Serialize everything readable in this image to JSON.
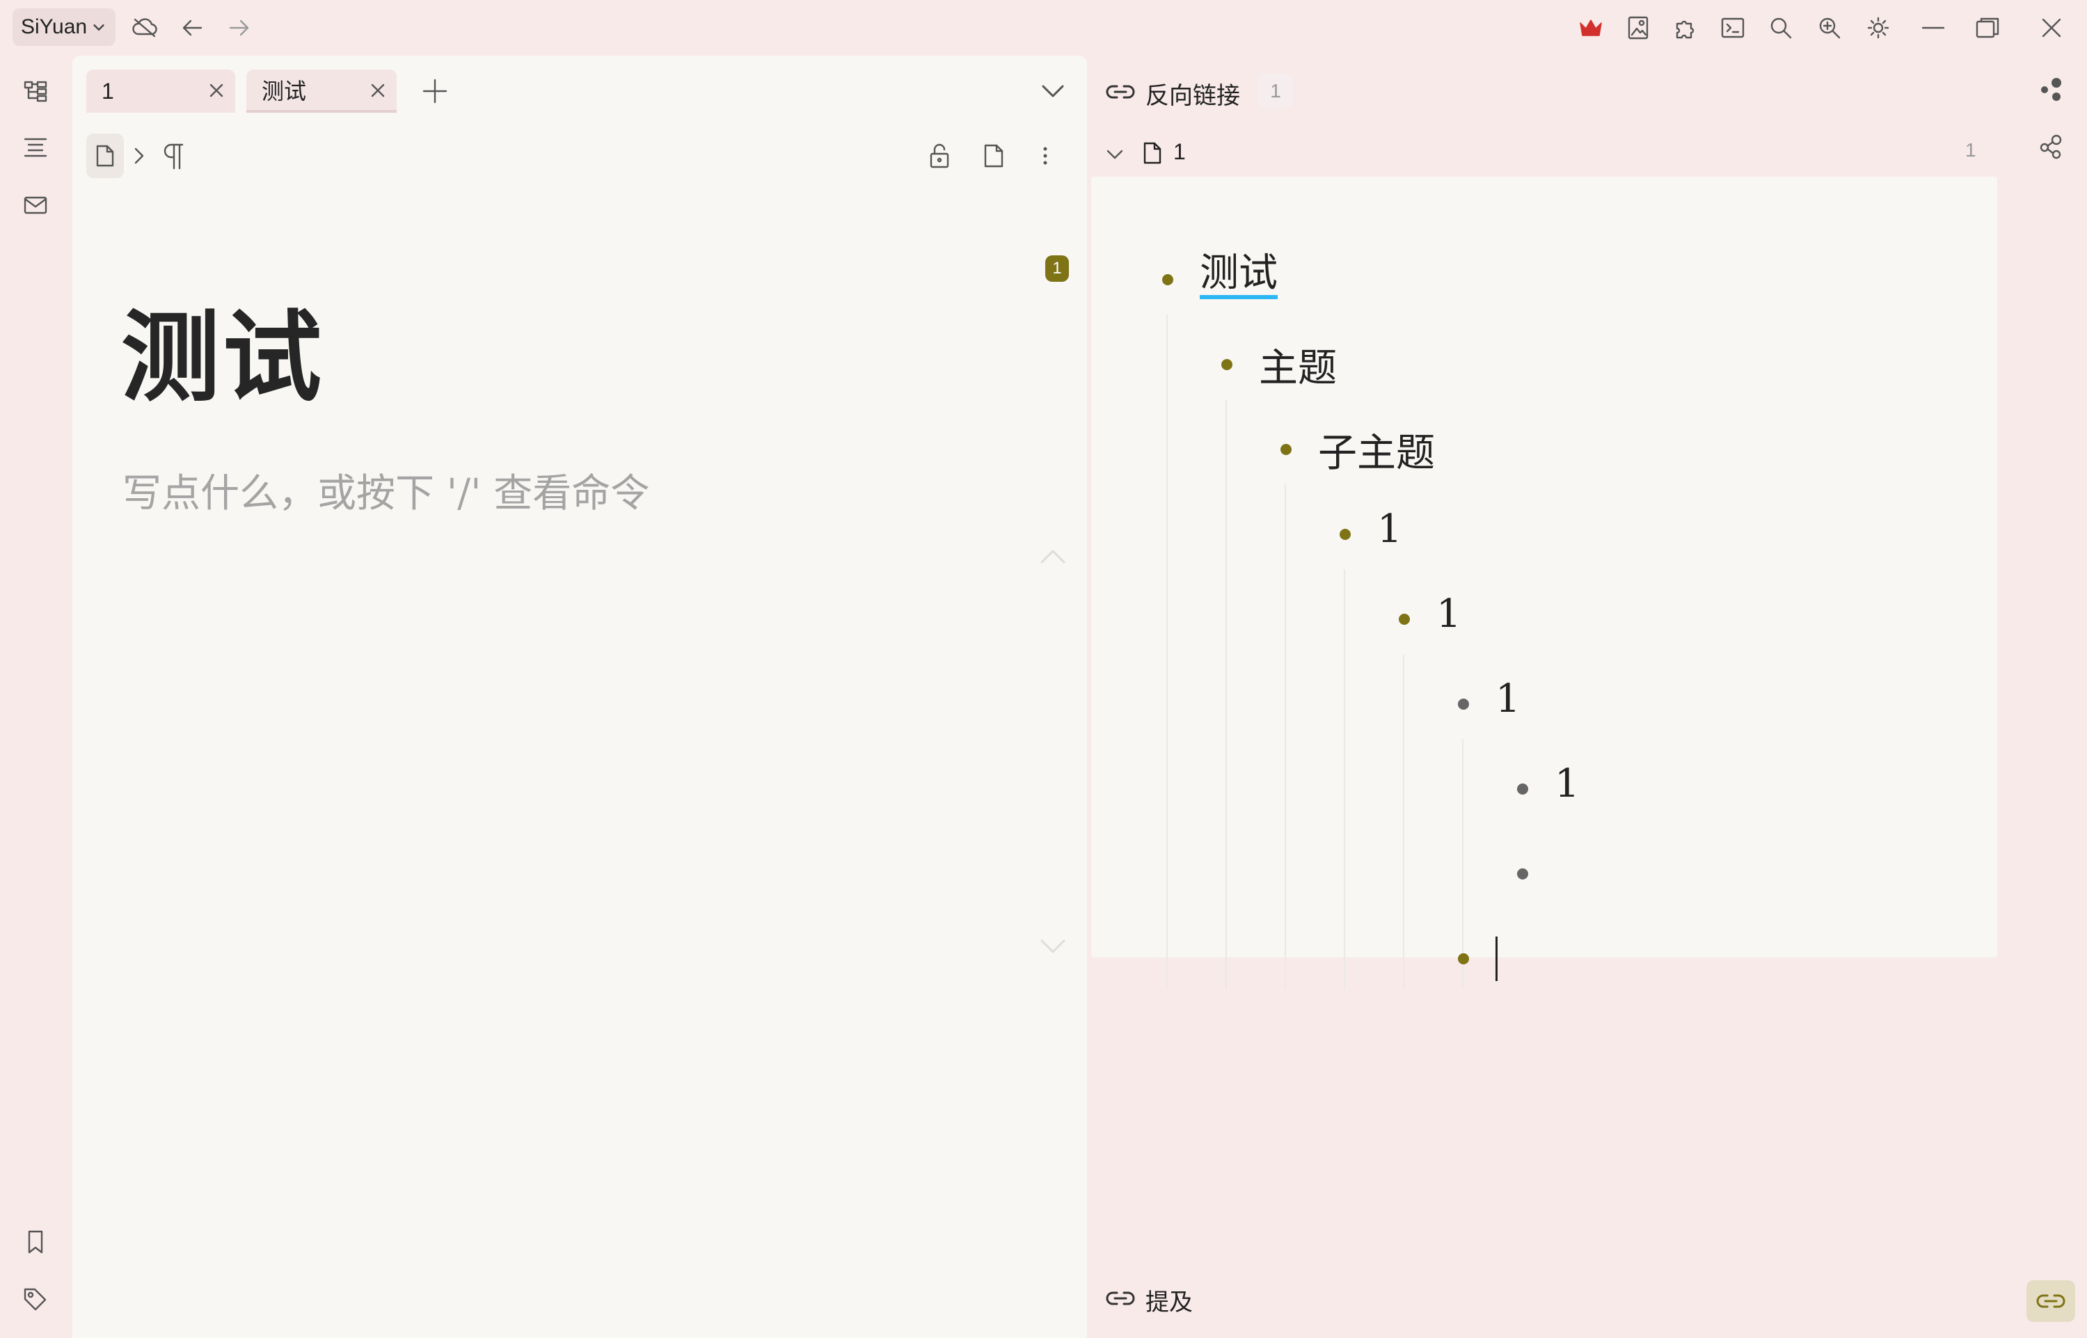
{
  "titlebar": {
    "workspace": "SiYuan",
    "icons": [
      "cloud-off-icon",
      "back-arrow-icon",
      "forward-arrow-icon",
      "crown-icon",
      "image-icon",
      "plugin-icon",
      "terminal-icon",
      "search-icon",
      "zoom-in-icon",
      "sun-icon",
      "minimize-icon",
      "restore-icon",
      "close-icon"
    ]
  },
  "left_dock": {
    "top_icons": [
      "file-tree-icon",
      "outline-icon",
      "inbox-icon"
    ],
    "bottom_icons": [
      "bookmark-icon",
      "tag-icon"
    ]
  },
  "editor": {
    "tabs": [
      {
        "label": "1",
        "active": false
      },
      {
        "label": "测试",
        "active": true
      }
    ],
    "breadcrumb_icons": [
      "doc-icon",
      "chevron-right-icon",
      "paragraph-icon"
    ],
    "toolbar_icons": [
      "lock-open-icon",
      "doc-info-icon",
      "more-icon"
    ],
    "title": "测试",
    "placeholder": "写点什么，或按下 '/' 查看命令",
    "backlink_badge": "1"
  },
  "backlinks": {
    "label": "反向链接",
    "count": "1",
    "doc": {
      "name": "1",
      "count": "1"
    },
    "items": [
      {
        "text": "测试",
        "level": 0,
        "ref": true,
        "bullet_color": "#7e7315"
      },
      {
        "text": "主题",
        "level": 1,
        "bullet_color": "#7e7315"
      },
      {
        "text": "子主题",
        "level": 2,
        "bullet_color": "#7e7315"
      },
      {
        "text": "1",
        "level": 3,
        "bullet_color": "#7e7315"
      },
      {
        "text": "1",
        "level": 4,
        "bullet_color": "#7e7315"
      },
      {
        "text": "1",
        "level": 5,
        "bullet_color": "#666666"
      },
      {
        "text": "1",
        "level": 6,
        "bullet_color": "#666666"
      },
      {
        "text": "",
        "level": 6,
        "bullet_color": "#666666"
      },
      {
        "text": "",
        "level": 5,
        "bullet_color": "#7e7315",
        "cursor": true
      }
    ]
  },
  "mentions": {
    "label": "提及"
  },
  "right_dock": {
    "icons": [
      "graph-icon",
      "global-graph-icon",
      "backlinks-icon"
    ]
  },
  "colors": {
    "accent": "#7e7315",
    "ref_underline": "#2db7f5",
    "background": "#f9eaea",
    "editor_bg": "#f8f7f4"
  }
}
